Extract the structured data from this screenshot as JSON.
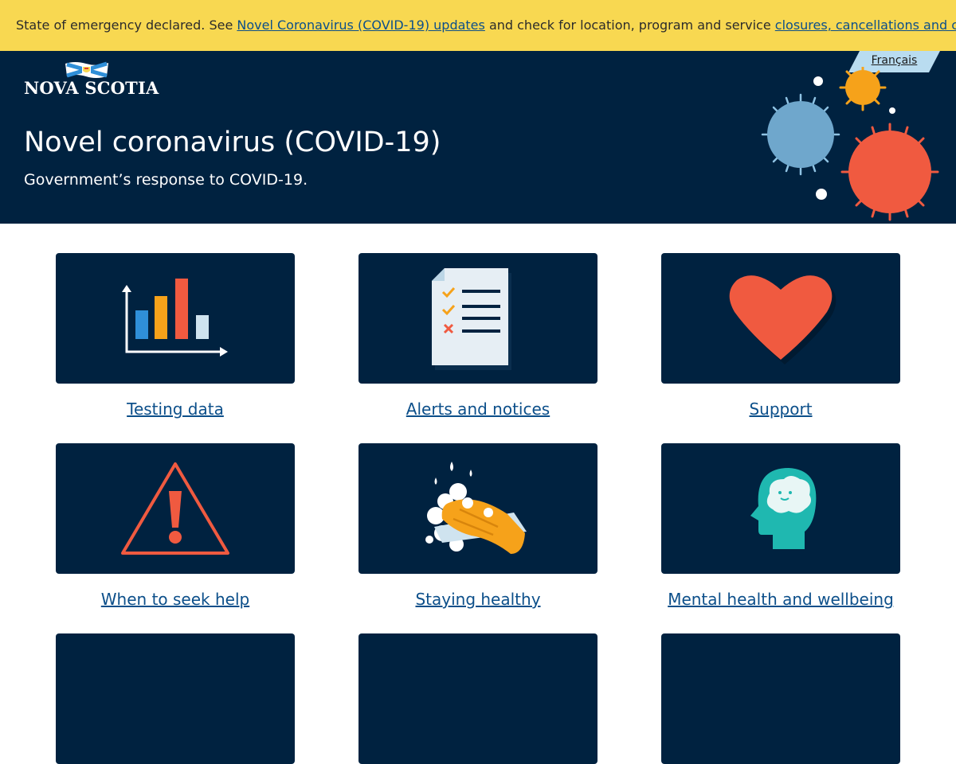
{
  "alert": {
    "text_before": "State of emergency declared. See ",
    "link1": "Novel Coronavirus (COVID-19) updates",
    "text_middle": " and check for location, program and service ",
    "link2": "closures, cancellations and changes",
    "text_after": "."
  },
  "header": {
    "logo_text": "NOVA SCOTIA",
    "language_link": "Français",
    "title": "Novel coronavirus (COVID-19)",
    "subtitle": "Government’s response to COVID-19."
  },
  "cards": [
    {
      "label": "Testing data",
      "icon": "bar-chart-icon"
    },
    {
      "label": "Alerts and notices",
      "icon": "checklist-document-icon"
    },
    {
      "label": "Support",
      "icon": "heart-icon"
    },
    {
      "label": "When to seek help",
      "icon": "warning-triangle-icon"
    },
    {
      "label": "Staying healthy",
      "icon": "hand-washing-icon"
    },
    {
      "label": "Mental health and wellbeing",
      "icon": "head-brain-icon"
    }
  ],
  "colors": {
    "alert_bg": "#f8d851",
    "hero_bg": "#002240",
    "link": "#0c4f8a",
    "language_tab": "#b9dcf0",
    "accent_red": "#f05a40",
    "accent_orange": "#f6a21a",
    "accent_blue": "#2f8fd8",
    "accent_teal": "#1fb8b0"
  }
}
